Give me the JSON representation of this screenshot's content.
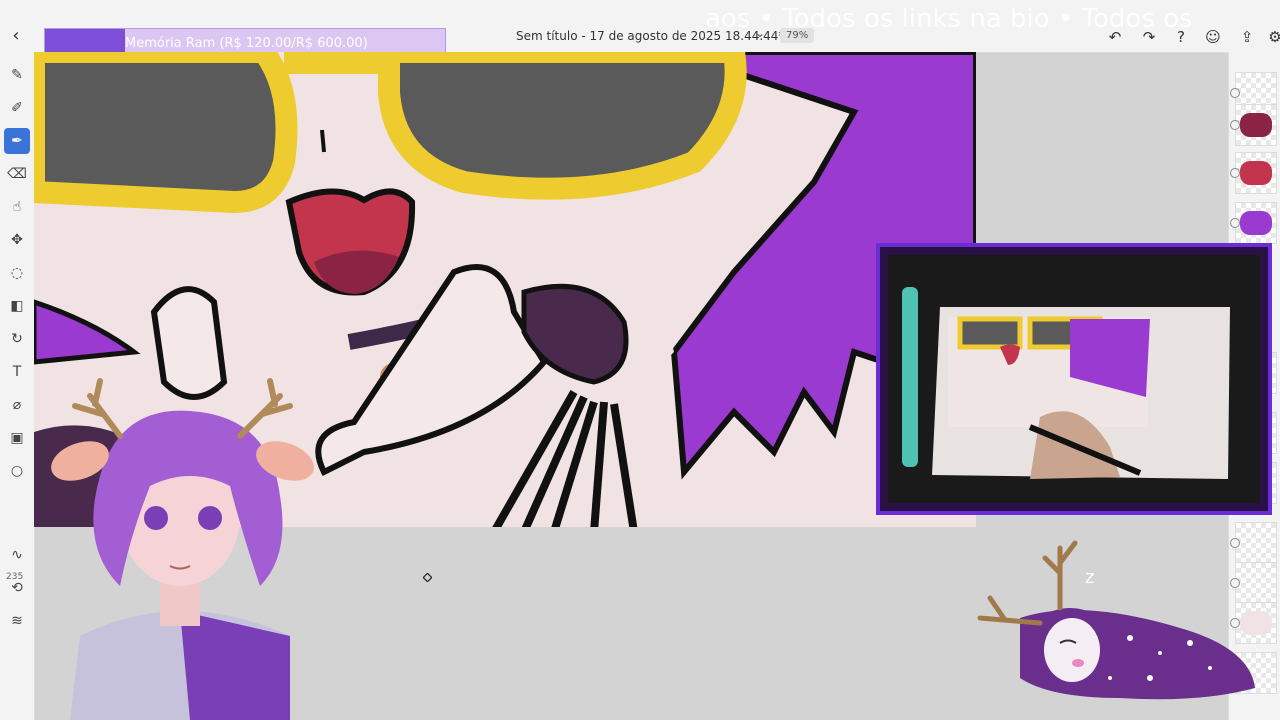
{
  "app": {
    "document_title": "Sem título - 17 de agosto de 2025 18.44.44*",
    "zoom": "79%",
    "overlay_text": "aos • Todos os links na bio • Todos os"
  },
  "ram_widget": {
    "label": "Memória Ram (R$ 120.00/R$ 600.00)",
    "progress": 0.2
  },
  "toolbar_right": [
    {
      "icon": "undo-icon",
      "glyph": "↶"
    },
    {
      "icon": "redo-icon",
      "glyph": "↷"
    },
    {
      "icon": "help-icon",
      "glyph": "?"
    },
    {
      "icon": "account-icon",
      "glyph": "☺"
    },
    {
      "icon": "share-icon",
      "glyph": "⇪"
    },
    {
      "icon": "settings-icon",
      "glyph": "⚙"
    }
  ],
  "tools": [
    {
      "name": "brush-tool-icon",
      "glyph": "✎",
      "active": false
    },
    {
      "name": "pencil-tool-icon",
      "glyph": "✐",
      "active": false
    },
    {
      "name": "ink-brush-tool-icon",
      "glyph": "✒",
      "active": true
    },
    {
      "name": "eraser-tool-icon",
      "glyph": "⌫",
      "active": false
    },
    {
      "name": "smudge-tool-icon",
      "glyph": "☝",
      "active": false
    },
    {
      "name": "move-tool-icon",
      "glyph": "✥",
      "active": false
    },
    {
      "name": "lasso-tool-icon",
      "glyph": "◌",
      "active": false
    },
    {
      "name": "fill-tool-icon",
      "glyph": "◧",
      "active": false
    },
    {
      "name": "liquify-tool-icon",
      "glyph": "↻",
      "active": false
    },
    {
      "name": "text-tool-icon",
      "glyph": "T",
      "active": false
    },
    {
      "name": "eyedropper-tool-icon",
      "glyph": "⌀",
      "active": false
    },
    {
      "name": "image-tool-icon",
      "glyph": "▣",
      "active": false
    },
    {
      "name": "color-swatch-icon",
      "glyph": "○",
      "active": false
    }
  ],
  "brush": {
    "size": "235",
    "more_tools": [
      {
        "name": "stroke-smoothing-icon",
        "glyph": "∿"
      },
      {
        "name": "symmetry-icon",
        "glyph": "⟲"
      },
      {
        "name": "adjust-icon",
        "glyph": "≋"
      }
    ]
  },
  "layers": [
    "layer-1",
    "layer-2",
    "layer-3",
    "layer-4",
    "layer-5",
    "layer-6",
    "layer-7",
    "layer-8",
    "layer-9",
    "layer-10",
    "layer-11"
  ],
  "colors": {
    "accent": "#3a74d8",
    "ram_fill": "#7d4fd9",
    "hair": "#9a3ad0",
    "glasses": "#eecb2e"
  }
}
